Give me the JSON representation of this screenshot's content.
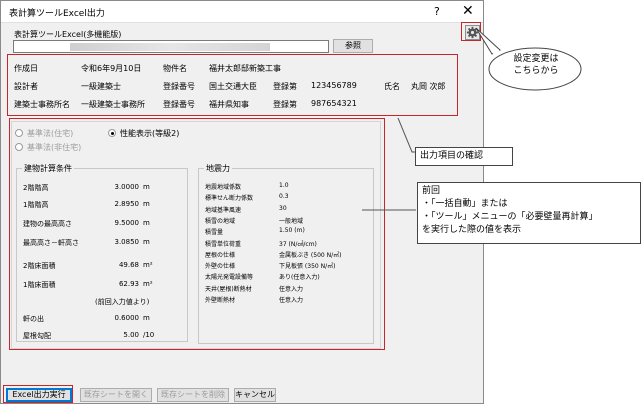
{
  "window": {
    "title": "表計算ツールExcel出力",
    "help_glyph": "?",
    "close_glyph": "✕"
  },
  "file": {
    "label": "表計算ツールExcel(多機能版)",
    "browse_label": "参照"
  },
  "info": {
    "created_label": "作成日",
    "created_value": "令和6年9月10日",
    "property_label": "物件名",
    "property_value": "福井太郎邸新築工事",
    "designer_label": "設計者",
    "designer_value": "一級建築士",
    "reg_no_label": "登録番号",
    "reg_authority": "国土交通大臣",
    "reg_label2": "登録第",
    "reg_no_value": "123456789",
    "name_label": "氏名",
    "name_value": "丸岡 次郎",
    "office_label": "建築士事務所名",
    "office_value": "一級建築士事務所",
    "office_reg_label": "登録番号",
    "office_reg_authority": "福井県知事",
    "office_reg_label2": "登録第",
    "office_reg_value": "987654321"
  },
  "options": {
    "law_house": "基準法(住宅)",
    "law_nonhouse": "基準法(非住宅)",
    "performance": "性能表示(等級2)"
  },
  "building": {
    "title": "建物計算条件",
    "rows": [
      {
        "label": "2階階高",
        "value": "3.0000",
        "unit": "m"
      },
      {
        "label": "1階階高",
        "value": "2.8950",
        "unit": "m"
      },
      {
        "label": "建物の最高高さ",
        "value": "9.5000",
        "unit": "m"
      },
      {
        "label": "最高高さ－軒高さ",
        "value": "3.0850",
        "unit": "m"
      },
      {
        "label": "2階床面積",
        "value": "49.68",
        "unit": "m²"
      },
      {
        "label": "1階床面積",
        "value": "62.93",
        "unit": "m²"
      },
      {
        "label": "",
        "value": "(前回入力値より)",
        "unit": ""
      },
      {
        "label": "軒の出",
        "value": "0.6000",
        "unit": "m"
      },
      {
        "label": "屋根勾配",
        "value": "5.00",
        "unit": "/10"
      }
    ]
  },
  "seismic": {
    "title": "地震力",
    "rows": [
      {
        "label": "地震地域係数",
        "value": "1.0"
      },
      {
        "label": "標準せん断力係数",
        "value": "0.3"
      },
      {
        "label": "地域基準風速",
        "value": "30"
      },
      {
        "label": "積雪の地域",
        "value": "一般地域"
      },
      {
        "label": "積雪量",
        "value": "1.50 (m)"
      },
      {
        "label": "積雪単位荷重",
        "value": "37 (N/㎠/cm)"
      },
      {
        "label": "屋根の仕様",
        "value": "金属板ぶき (500 N/㎡)"
      },
      {
        "label": "外壁の仕様",
        "value": "下見板張 (350 N/㎡)"
      },
      {
        "label": "太陽光発電設備等",
        "value": "あり(任意入力)"
      },
      {
        "label": "天井(屋根)断熱材",
        "value": "任意入力"
      },
      {
        "label": "外壁断熱材",
        "value": "任意入力"
      }
    ]
  },
  "buttons": {
    "export": "Excel出力実行",
    "open_sheet": "既存シートを開く",
    "delete_sheet": "既存シートを削除",
    "cancel": "キャンセル"
  },
  "callouts": {
    "settings": "設定変更は\nこちらから",
    "output_items": "出力項目の確認",
    "previous": "前回\n・「一括自動」または\n・「ツール」メニューの「必要壁量再計算」\nを実行した際の値を表示"
  },
  "colors": {
    "annotation_red": "#c3272b",
    "default_button_border": "#0078d7",
    "dialog_bg": "#f0f0f0"
  }
}
